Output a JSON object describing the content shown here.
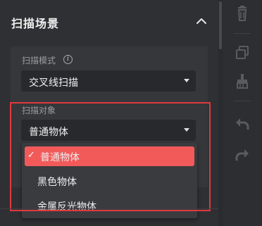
{
  "panel": {
    "title": "扫描场景",
    "collapse_icon": "chevron-up-icon"
  },
  "scan_mode": {
    "label": "扫描模式",
    "info_icon": "info-icon",
    "info_glyph": "i",
    "value": "交叉线扫描"
  },
  "scan_object": {
    "label": "扫描对象",
    "value": "普通物体",
    "options": [
      {
        "label": "普通物体",
        "selected": true
      },
      {
        "label": "黑色物体",
        "selected": false
      },
      {
        "label": "金属反光物体",
        "selected": false
      }
    ]
  },
  "check_glyph": "✓",
  "colors": {
    "selected_option": "#f25a5a",
    "highlight_border": "#e0393f",
    "background": "#2d2e31"
  },
  "toolbar": {
    "icons": [
      "trash-icon",
      "copy-icon",
      "brush-icon",
      "undo-icon",
      "redo-icon"
    ]
  }
}
